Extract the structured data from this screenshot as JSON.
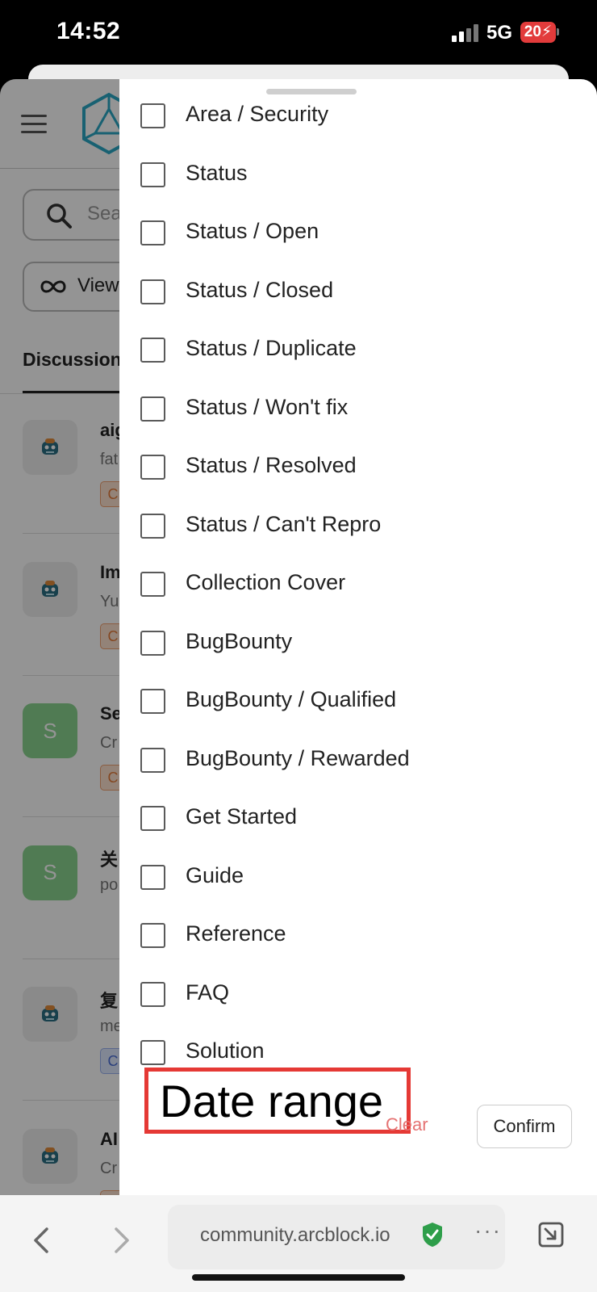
{
  "status_bar": {
    "time": "14:52",
    "network": "5G",
    "battery": "20"
  },
  "background_page": {
    "search_placeholder": "Sea",
    "view_label": "View",
    "tab_label": "Discussion",
    "discussions": [
      {
        "title": "aig",
        "subtitle": "fat",
        "tag": "C",
        "avatar": "robot",
        "tag_color": "orange"
      },
      {
        "title": "Im",
        "subtitle": "Yu",
        "tag": "C",
        "avatar": "robot",
        "tag_color": "orange"
      },
      {
        "title": "Se",
        "subtitle": "Cr",
        "tag": "C",
        "avatar": "S",
        "tag_color": "orange"
      },
      {
        "title": "关",
        "subtitle": "po",
        "tag": "",
        "avatar": "S",
        "tag_color": ""
      },
      {
        "title": "复",
        "subtitle": "me",
        "tag": "C",
        "avatar": "robot",
        "tag_color": "blue"
      },
      {
        "title": "AI",
        "subtitle": "Cr",
        "tag": "C",
        "avatar": "robot",
        "tag_color": "orange"
      }
    ]
  },
  "filter_sheet": {
    "options": [
      "Area / Security",
      "Status",
      "Status / Open",
      "Status / Closed",
      "Status / Duplicate",
      "Status / Won't fix",
      "Status / Resolved",
      "Status / Can't Repro",
      "Collection Cover",
      "BugBounty",
      "BugBounty / Qualified",
      "BugBounty / Rewarded",
      "Get Started",
      "Guide",
      "Reference",
      "FAQ",
      "Solution"
    ],
    "date_range_label": "Date range",
    "clear_label": "Clear",
    "confirm_label": "Confirm"
  },
  "browser": {
    "url": "community.arcblock.io",
    "more_label": "···"
  },
  "colors": {
    "annotation_red": "#e53935",
    "clear_red": "#e57373",
    "secure_green": "#2e9e4a"
  }
}
